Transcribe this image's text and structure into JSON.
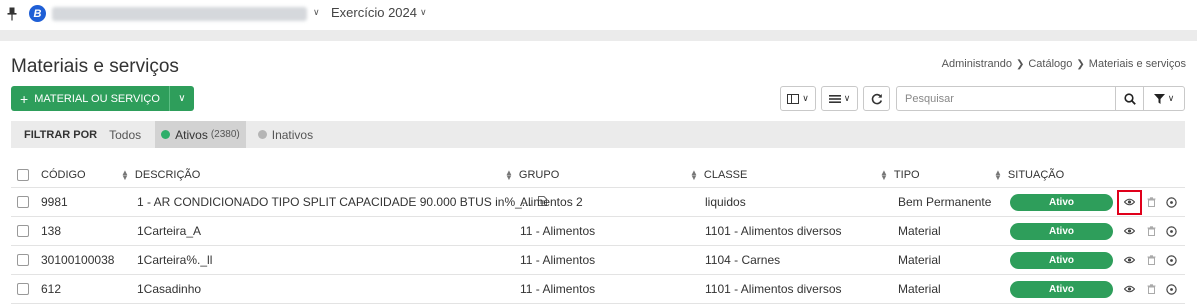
{
  "topbar": {
    "org_initial": "B",
    "exercise_label": "Exercício 2024"
  },
  "page": {
    "title": "Materiais e serviços",
    "breadcrumb": [
      "Administrando",
      "Catálogo",
      "Materiais e serviços"
    ]
  },
  "toolbar": {
    "add_label": "MATERIAL OU SERVIÇO",
    "search_placeholder": "Pesquisar"
  },
  "filter": {
    "label": "FILTRAR POR",
    "options": [
      {
        "label": "Todos",
        "count": ""
      },
      {
        "label": "Ativos",
        "count": "(2380)"
      },
      {
        "label": "Inativos",
        "count": ""
      }
    ],
    "active_color": "#2eae6a",
    "inactive_color": "#b5b5b5"
  },
  "table": {
    "headers": [
      "CÓDIGO",
      "DESCRIÇÃO",
      "GRUPO",
      "CLASSE",
      "TIPO",
      "SITUAÇÃO"
    ],
    "rows": [
      {
        "codigo": "9981",
        "descricao": "1 - AR CONDICIONADO TIPO SPLIT CAPACIDADE 90.000 BTUS in%_...",
        "grupo": "Alimentos 2",
        "classe": "liquidos",
        "tipo": "Bem Permanente",
        "situacao": "Ativo"
      },
      {
        "codigo": "138",
        "descricao": "1Carteira_A",
        "grupo": "11 - Alimentos",
        "classe": "1101 - Alimentos diversos",
        "tipo": "Material",
        "situacao": "Ativo"
      },
      {
        "codigo": "30100100038",
        "descricao": "1Carteira%._ll",
        "grupo": "11 - Alimentos",
        "classe": "1104 - Carnes",
        "tipo": "Material",
        "situacao": "Ativo"
      },
      {
        "codigo": "612",
        "descricao": "1Casadinho",
        "grupo": "11 - Alimentos",
        "classe": "1101 - Alimentos diversos",
        "tipo": "Material",
        "situacao": "Ativo"
      }
    ]
  },
  "colors": {
    "primary": "#2e9e5b",
    "status": "#2e9e5b",
    "highlight": "#e0001b"
  }
}
